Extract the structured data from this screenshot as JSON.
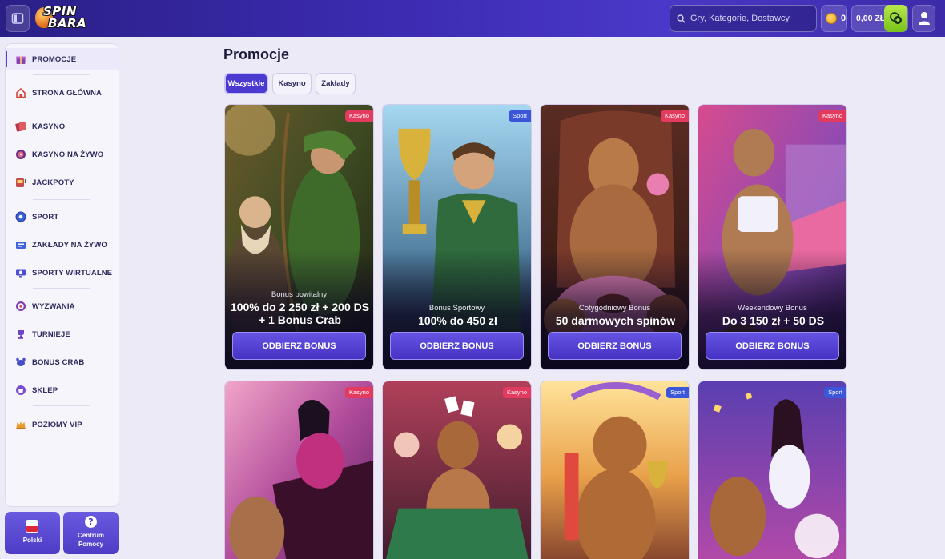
{
  "header": {
    "logo_text_1": "SPIN",
    "logo_text_2": "BARA",
    "search_placeholder": "Gry, Kategorie, Dostawcy",
    "coins": "0",
    "balance": "0,00 ZŁ"
  },
  "sidebar": {
    "items": [
      {
        "label": "PROMOCJE",
        "icon": "gift-icon"
      },
      {
        "label": "STRONA GŁÓWNA",
        "icon": "home-icon"
      },
      {
        "label": "KASYNO",
        "icon": "cards-icon"
      },
      {
        "label": "KASYNO NA ŻYWO",
        "icon": "roulette-icon"
      },
      {
        "label": "JACKPOTY",
        "icon": "slot-icon"
      },
      {
        "label": "SPORT",
        "icon": "ball-icon"
      },
      {
        "label": "ZAKŁADY NA ŻYWO",
        "icon": "live-ticket-icon"
      },
      {
        "label": "SPORTY WIRTUALNE",
        "icon": "virtual-icon"
      },
      {
        "label": "WYZWANIA",
        "icon": "target-icon"
      },
      {
        "label": "TURNIEJE",
        "icon": "trophy-icon"
      },
      {
        "label": "BONUS CRAB",
        "icon": "crab-icon"
      },
      {
        "label": "SKLEP",
        "icon": "shop-icon"
      },
      {
        "label": "POZIOMY VIP",
        "icon": "crown-icon"
      }
    ],
    "language_label": "Polski",
    "help_label_1": "Centrum",
    "help_label_2": "Pomocy"
  },
  "main": {
    "title": "Promocje",
    "tabs": [
      {
        "label": "Wszystkie"
      },
      {
        "label": "Kasyno"
      },
      {
        "label": "Zakłady"
      }
    ],
    "claim_label": "ODBIERZ BONUS",
    "cards": [
      {
        "tag": "Kasyno",
        "subtitle": "Bonus powitalny",
        "headline_1": "100% do 2 250 zł + 200 DS",
        "headline_2": "+ 1 Bonus Crab"
      },
      {
        "tag": "Sport",
        "subtitle": "Bonus Sportowy",
        "headline_1": "100% do 450 zł",
        "headline_2": ""
      },
      {
        "tag": "Kasyno",
        "subtitle": "Cotygodniowy Bonus",
        "headline_1": "50 darmowych spinów",
        "headline_2": ""
      },
      {
        "tag": "Kasyno",
        "subtitle": "Weekendowy Bonus",
        "headline_1": "Do 3 150 zł + 50 DS",
        "headline_2": ""
      },
      {
        "tag": "Kasyno"
      },
      {
        "tag": "Kasyno"
      },
      {
        "tag": "Sport"
      },
      {
        "tag": "Sport"
      }
    ]
  },
  "colors": {
    "header": "#3b2bb0",
    "accent": "#4b3ad0",
    "casino_tag": "#e33a5f",
    "sport_tag": "#3b56d9"
  }
}
